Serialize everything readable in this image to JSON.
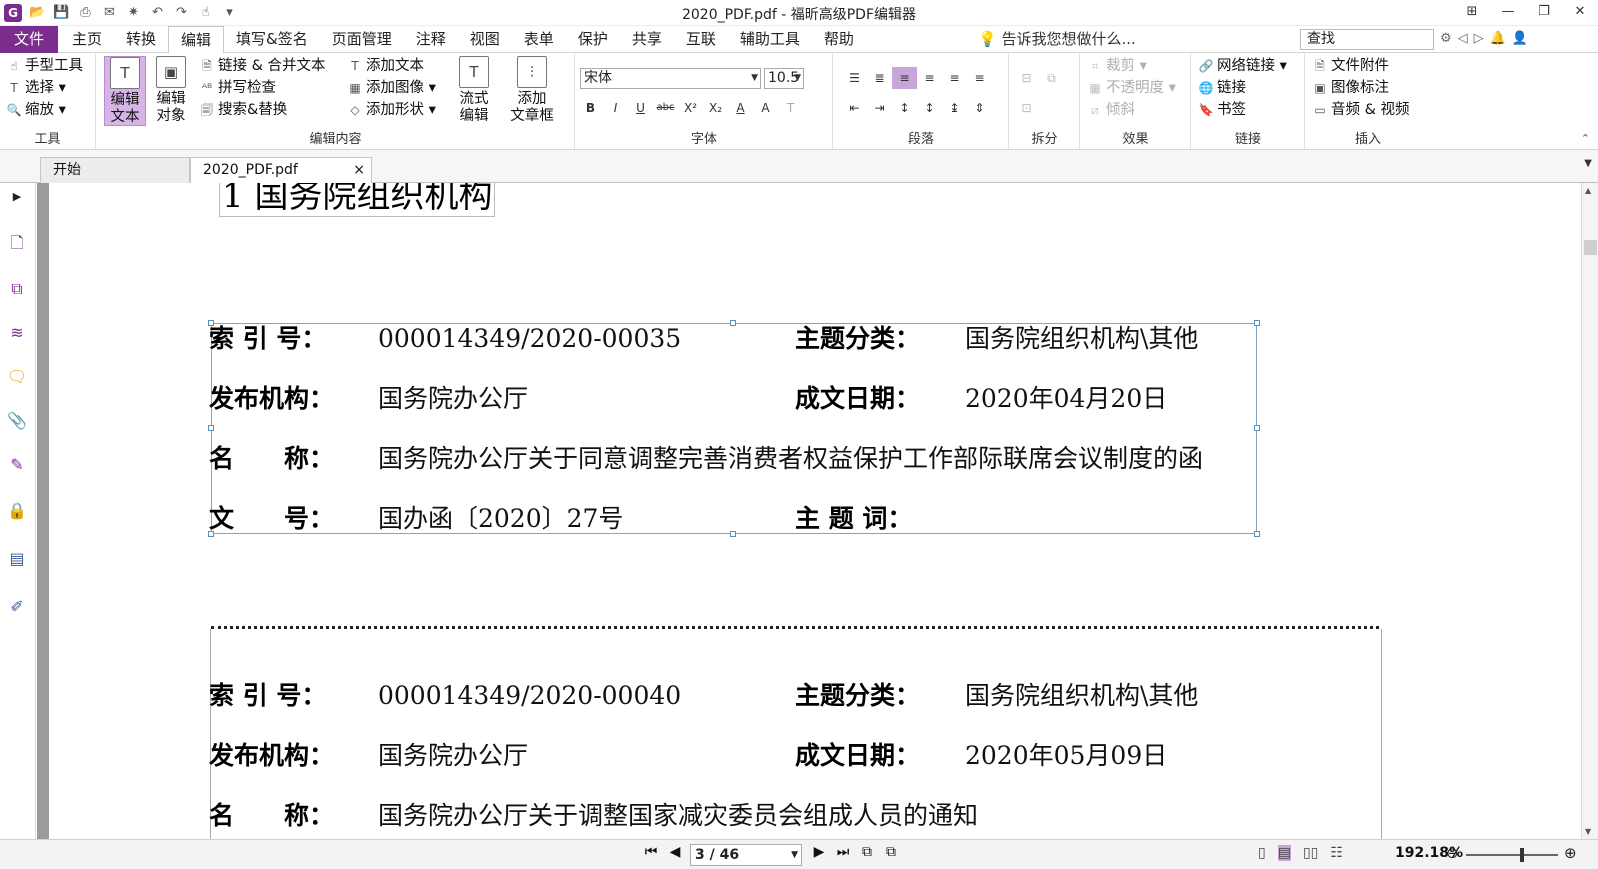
{
  "title_bar": {
    "app_icon_letter": "G",
    "window_title": "2020_PDF.pdf - 福昕高级PDF编辑器",
    "quick_access": [
      "open-folder-icon",
      "save-icon",
      "print-icon",
      "email-icon",
      "star-icon",
      "undo-icon",
      "redo-icon",
      "hand-icon",
      "more-icon"
    ],
    "controls": {
      "layout": "⊞",
      "minimize": "—",
      "restore": "❐",
      "close": "✕"
    }
  },
  "menu": {
    "file": "文件",
    "tabs": [
      "主页",
      "转换",
      "编辑",
      "填写&签名",
      "页面管理",
      "注释",
      "视图",
      "表单",
      "保护",
      "共享",
      "互联",
      "辅助工具",
      "帮助"
    ],
    "active_tab": "编辑",
    "tell_me": "告诉我您想做什么...",
    "find_placeholder": "查找"
  },
  "ribbon": {
    "tools": {
      "label": "工具",
      "items": [
        "手型工具",
        "选择",
        "缩放"
      ]
    },
    "edit_content": {
      "label": "编辑内容",
      "big_edit_text": "编辑\n文本",
      "big_edit_object": "编辑\n对象",
      "items_col1": [
        "链接 & 合并文本",
        "拼写检查",
        "搜索&替换"
      ],
      "items_col2": [
        "添加文本",
        "添加图像",
        "添加形状"
      ],
      "flow_edit": "流式\n编辑",
      "add_article": "添加\n文章框"
    },
    "font": {
      "label": "字体",
      "font_name": "宋体",
      "font_size": "10.5",
      "format_buttons": [
        "B",
        "I",
        "U",
        "abc",
        "X²",
        "X₂",
        "A",
        "A",
        "T"
      ]
    },
    "paragraph": {
      "label": "段落"
    },
    "split": {
      "label": "拆分"
    },
    "effects": {
      "label": "效果",
      "items": [
        "裁剪",
        "不透明度",
        "倾斜"
      ]
    },
    "links": {
      "label": "链接",
      "items": [
        "网络链接",
        "链接",
        "书签"
      ]
    },
    "insert": {
      "label": "插入",
      "items": [
        "文件附件",
        "图像标注",
        "音频 & 视频"
      ]
    }
  },
  "doc_tabs": {
    "start": "开始",
    "current": "2020_PDF.pdf"
  },
  "document": {
    "heading": "1  国务院组织机构",
    "record1": {
      "index_label": "索 引 号：",
      "index": "000014349/2020-00035",
      "topic_label": "主题分类：",
      "topic": "国务院组织机构\\其他",
      "issuer_label": "发布机构：",
      "issuer": "国务院办公厅",
      "date_label": "成文日期：",
      "date": "2020年04月20日",
      "name_label": "名　　称：",
      "name": "国务院办公厅关于同意调整完善消费者权益保护工作部际联席会议制度的函",
      "docno_label": "文　　号：",
      "docno": "国办函〔2020〕27号",
      "keywords_label": "主 题 词：",
      "keywords": ""
    },
    "record2": {
      "index_label": "索 引 号：",
      "index": "000014349/2020-00040",
      "topic_label": "主题分类：",
      "topic": "国务院组织机构\\其他",
      "issuer_label": "发布机构：",
      "issuer": "国务院办公厅",
      "date_label": "成文日期：",
      "date": "2020年05月09日",
      "name_label": "名　　称：",
      "name": "国务院办公厅关于调整国家减灾委员会组成人员的通知"
    }
  },
  "status": {
    "page": "3 / 46",
    "zoom": "192.18%"
  }
}
